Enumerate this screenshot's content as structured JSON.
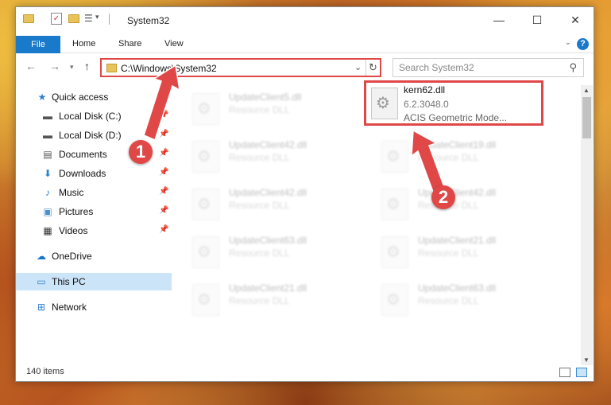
{
  "window": {
    "title": "System32",
    "controls": {
      "minimize": "—",
      "maximize": "☐",
      "close": "✕"
    }
  },
  "ribbon": {
    "tabs": [
      "File",
      "Home",
      "Share",
      "View"
    ],
    "help": "?"
  },
  "nav": {
    "address": "C:\\Windows\\System32",
    "search_placeholder": "Search System32"
  },
  "sidebar": {
    "items": [
      {
        "label": "Quick access",
        "icon": "star-icon"
      },
      {
        "label": "Local Disk (C:)",
        "icon": "drive-icon",
        "pinned": true
      },
      {
        "label": "Local Disk (D:)",
        "icon": "drive-icon",
        "pinned": true
      },
      {
        "label": "Documents",
        "icon": "documents-icon",
        "pinned": true
      },
      {
        "label": "Downloads",
        "icon": "downloads-icon",
        "pinned": true
      },
      {
        "label": "Music",
        "icon": "music-icon",
        "pinned": true
      },
      {
        "label": "Pictures",
        "icon": "pictures-icon",
        "pinned": true
      },
      {
        "label": "Videos",
        "icon": "videos-icon",
        "pinned": true
      },
      {
        "label": "OneDrive",
        "icon": "cloud-icon"
      },
      {
        "label": "This PC",
        "icon": "computer-icon",
        "selected": true
      },
      {
        "label": "Network",
        "icon": "network-icon"
      }
    ]
  },
  "files": {
    "highlighted": {
      "name": "kern62.dll",
      "version": "6.2.3048.0",
      "description": "ACIS Geometric Mode..."
    },
    "left_column": [
      {
        "name": "UpdateClient5.dll",
        "type": "Resource DLL"
      },
      {
        "name": "UpdateClient42.dll",
        "type": "Resource DLL"
      },
      {
        "name": "UpdateClient42.dll",
        "type": "Resource DLL"
      },
      {
        "name": "UpdateClient63.dll",
        "type": "Resource DLL"
      },
      {
        "name": "UpdateClient21.dll",
        "type": "Resource DLL"
      }
    ],
    "right_column": [
      {
        "name": "UpdateClient19.dll",
        "type": "Resource DLL"
      },
      {
        "name": "UpdateClient42.dll",
        "type": "Resource DLL"
      },
      {
        "name": "UpdateClient21.dll",
        "type": "Resource DLL"
      },
      {
        "name": "UpdateClient63.dll",
        "type": "Resource DLL"
      }
    ]
  },
  "status": {
    "item_count": "140 items"
  },
  "annotations": {
    "step1": "1",
    "step2": "2",
    "color": "#e04848"
  }
}
